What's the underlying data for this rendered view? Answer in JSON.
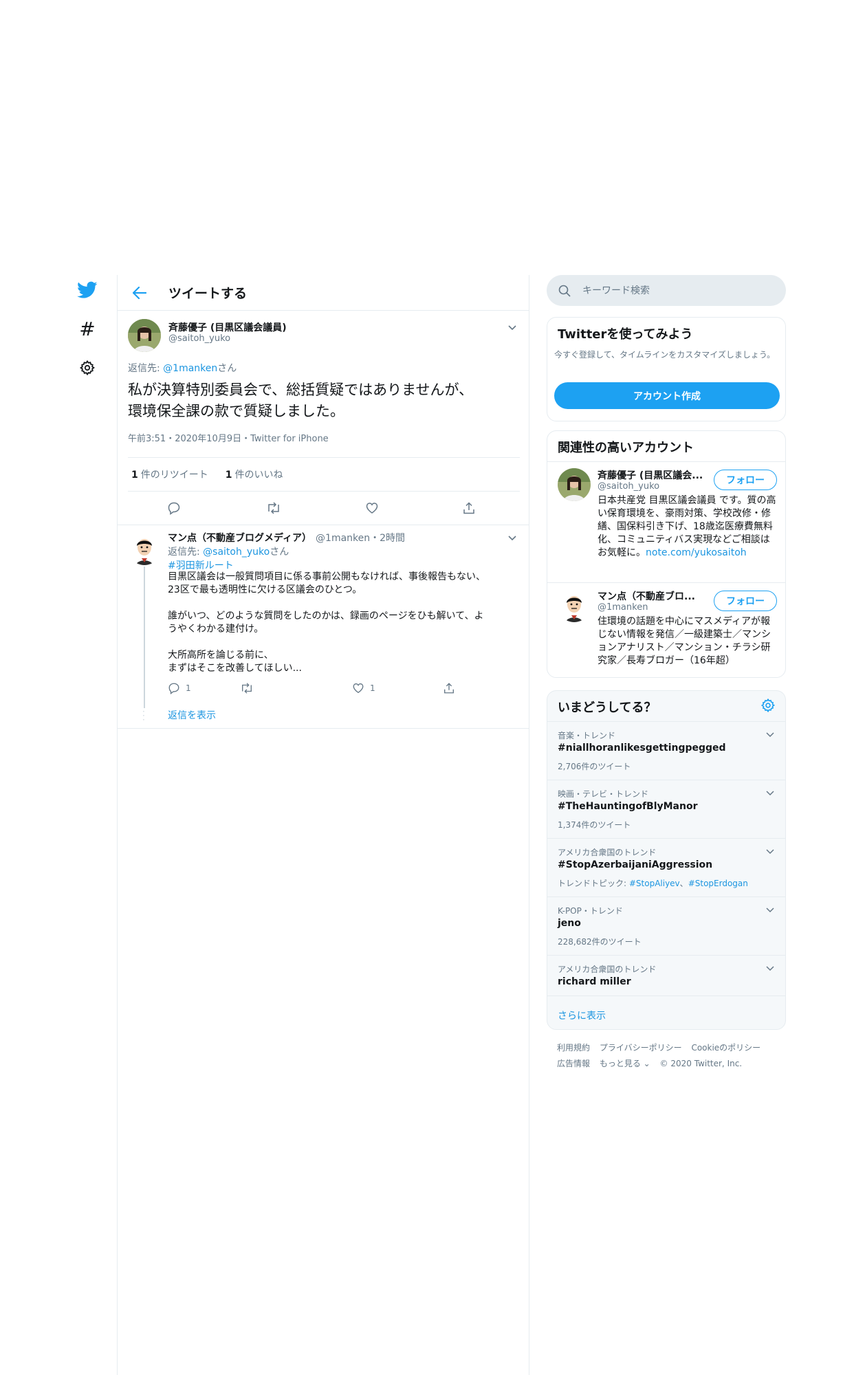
{
  "nav": {
    "icons": [
      "twitter-bird-icon",
      "hashtag-icon",
      "gear-icon"
    ],
    "hashtag_glyph": "#"
  },
  "header": {
    "title": "ツイートする"
  },
  "main_tweet": {
    "author_name": "斉藤優子 (目黒区議会議員)",
    "author_handle": "@saitoh_yuko",
    "reply_prefix": "返信先: ",
    "reply_to": "@1manken",
    "reply_suffix": "さん",
    "body_line1": "私が決算特別委員会で、総括質疑ではありませんが、",
    "body_line2": "環境保全課の款で質疑しました。",
    "meta": "午前3:51・2020年10月9日・Twitter for iPhone",
    "retweet_count": "1",
    "retweet_label": "件のリツイート",
    "like_count": "1",
    "like_label": "件のいいね"
  },
  "reply_tweet": {
    "author_name": "マン点（不動産ブログメディア）",
    "handle_time": "@1manken・2時間",
    "reply_prefix": "返信先: ",
    "reply_to": "@saitoh_yuko",
    "reply_suffix": "さん",
    "hashtag": "#羽田新ルート",
    "para1_line1": "目黒区議会は一般質問項目に係る事前公開もなければ、事後報告もない、",
    "para1_line2": "23区で最も透明性に欠ける区議会のひとつ。",
    "para2_line1": "誰がいつ、どのような質問をしたのかは、録画のページをひも解いて、よ",
    "para2_line2": "うやくわかる建付け。",
    "para3_line1": "大所高所を論じる前に、",
    "para3_line2": "まずはそこを改善してほしい...",
    "reply_count": "1",
    "like_count": "1",
    "show_replies": "返信を表示"
  },
  "search": {
    "placeholder": "キーワード検索"
  },
  "signup": {
    "title": "Twitterを使ってみよう",
    "description": "今すぐ登録して、タイムラインをカスタマイズしましょう。",
    "button": "アカウント作成"
  },
  "related": {
    "title": "関連性の高いアカウント",
    "accounts": [
      {
        "name": "斉藤優子 (目黒区議会...",
        "handle": "@saitoh_yuko",
        "follow": "フォロー",
        "bio": "日本共産党 目黒区議会議員 です。質の高い保育環境を、豪雨対策、学校改修・修繕、国保料引き下げ、18歳迄医療費無料化、コミュニティバス実現などご相談はお気軽に。",
        "bio_link": "note.com/yukosaitoh"
      },
      {
        "name": "マン点（不動産ブロ...",
        "handle": "@1manken",
        "follow": "フォロー",
        "bio": "住環境の話題を中心にマスメディアが報じない情報を発信／一級建築士／マンションアナリスト／マンション・チラシ研究家／長寿ブロガー（16年超）"
      }
    ]
  },
  "trends": {
    "title": "いまどうしてる？",
    "items": [
      {
        "context": "音楽・トレンド",
        "name": "#niallhoranlikesgettingpegged",
        "count": "2,706件のツイート"
      },
      {
        "context": "映画・テレビ・トレンド",
        "name": "#TheHauntingofBlyManor",
        "count": "1,374件のツイート"
      },
      {
        "context": "アメリカ合衆国のトレンド",
        "name": "#StopAzerbaijaniAggression",
        "topic_prefix": "トレンドトピック: ",
        "topic1": "#StopAliyev",
        "topic_sep": "、",
        "topic2": "#StopErdogan"
      },
      {
        "context": "K-POP・トレンド",
        "name": "jeno",
        "count": "228,682件のツイート"
      },
      {
        "context": "アメリカ合衆国のトレンド",
        "name": "richard miller"
      }
    ],
    "show_more": "さらに表示"
  },
  "footer": {
    "terms": "利用規約",
    "privacy": "プライバシーポリシー",
    "cookie": "Cookieのポリシー",
    "ads": "広告情報",
    "more": "もっと見る ⌄",
    "copyright": "© 2020 Twitter, Inc."
  },
  "colors": {
    "accent": "#1da1f2",
    "link": "#1b95e0",
    "secondary_text": "#657786",
    "border": "#e6ecf0",
    "card_bg": "#f5f8fa"
  }
}
